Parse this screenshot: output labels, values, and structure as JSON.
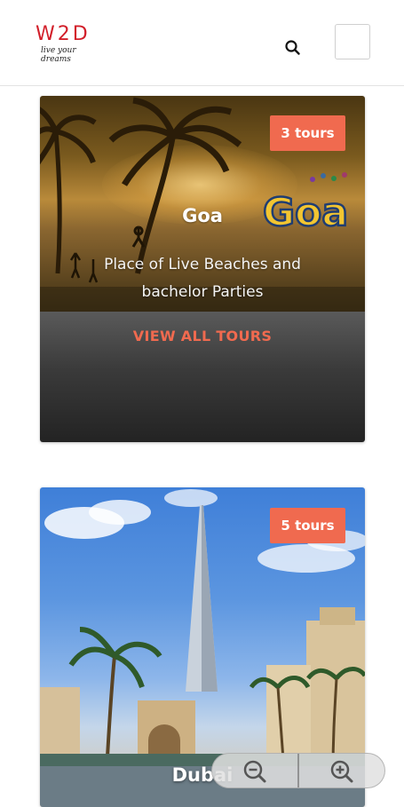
{
  "header": {
    "logo_main": "W2D",
    "logo_tagline": "live your dreams",
    "search_icon": "search-icon",
    "menu_icon": "menu-icon"
  },
  "cards": [
    {
      "title": "Goa",
      "badge": "3 tours",
      "description": "Place of Live Beaches and bachelor Parties",
      "cta": "VIEW ALL TOURS"
    },
    {
      "title": "Dubai",
      "badge": "5 tours"
    }
  ],
  "zoom": {
    "zoom_out_icon": "zoom-out-icon",
    "zoom_in_icon": "zoom-in-icon"
  },
  "colors": {
    "brand_red": "#d21f2a",
    "accent_orange": "#f06a4f"
  }
}
